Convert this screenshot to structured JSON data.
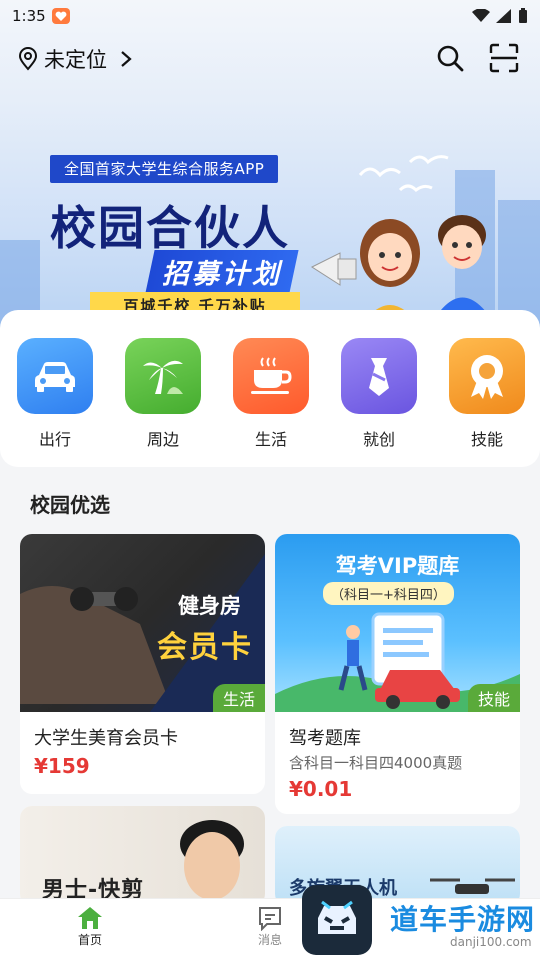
{
  "status_bar": {
    "time": "1:35"
  },
  "header": {
    "location": "未定位"
  },
  "banner": {
    "tag": "全国首家大学生综合服务APP",
    "title": "校园合伙人",
    "subtitle": "招募计划",
    "strip": "百城千校 千万补贴"
  },
  "categories": [
    {
      "label": "出行",
      "icon": "car-icon",
      "color": "#3f8ff0"
    },
    {
      "label": "周边",
      "icon": "palm-tree-icon",
      "color": "#5cbf3d"
    },
    {
      "label": "生活",
      "icon": "coffee-cup-icon",
      "color": "#ff6a3a"
    },
    {
      "label": "就创",
      "icon": "necktie-icon",
      "color": "#7b66e8"
    },
    {
      "label": "技能",
      "icon": "medal-icon",
      "color": "#f39a2b"
    }
  ],
  "section": {
    "title": "校园优选"
  },
  "products": [
    {
      "image_line1": "健身房",
      "image_line2": "会员卡",
      "tag": "生活",
      "title": "大学生美育会员卡",
      "price": "¥159"
    },
    {
      "image_line1": "驾考VIP题库",
      "image_line2": "（科目一+科目四）",
      "tag": "技能",
      "title": "驾考题库",
      "desc": "含科目一科目四4000真题",
      "price": "¥0.01"
    },
    {
      "image_line1": "男士-快剪"
    },
    {
      "image_line1": "多旋翼无人机"
    }
  ],
  "bottom_nav": {
    "home": "首页",
    "messages": "消息"
  },
  "watermark": {
    "text": "道车手游网",
    "small": "danji100.com"
  }
}
